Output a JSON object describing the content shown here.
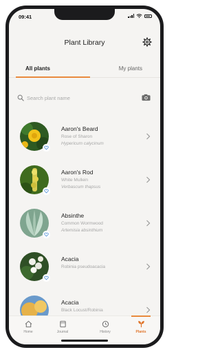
{
  "status": {
    "time": "09:41"
  },
  "header": {
    "title": "Plant Library"
  },
  "tabs": [
    {
      "label": "All plants",
      "active": true
    },
    {
      "label": "My plants",
      "active": false
    }
  ],
  "search": {
    "placeholder": "Search plant name"
  },
  "plants": [
    {
      "name": "Aaron's Beard",
      "common": "Rose of Sharon",
      "latin": "Hypericum calycinum"
    },
    {
      "name": "Aaron's Rod",
      "common": "White Mullein",
      "latin": "Verbascum thapsus"
    },
    {
      "name": "Absinthe",
      "common": "Common Wormwood",
      "latin": "Artemisia absinthium"
    },
    {
      "name": "Acacia",
      "common": "Robinia pseudoacacia",
      "latin": ""
    },
    {
      "name": "Acacia",
      "common": "Black Locust/Robinia",
      "latin": ""
    }
  ],
  "nav": [
    {
      "label": "Home",
      "icon": "home-icon"
    },
    {
      "label": "Journal",
      "icon": "journal-icon"
    },
    {
      "label": "History",
      "icon": "history-icon"
    },
    {
      "label": "Plants",
      "icon": "plants-icon",
      "active": true
    }
  ],
  "colors": {
    "accent": "#e98a3d",
    "background": "#f5f4f2"
  }
}
